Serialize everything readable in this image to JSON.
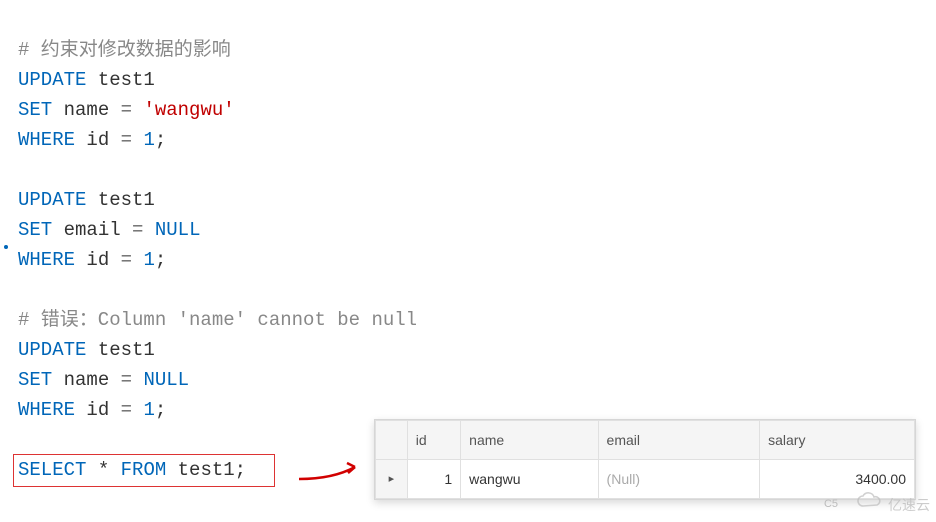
{
  "code": {
    "comment1": "# 约束对修改数据的影响",
    "kw_update1": "UPDATE",
    "tbl": "test1",
    "kw_set1": "SET",
    "field_name": "name",
    "op_eq": "=",
    "str_wangwu": "'wangwu'",
    "kw_where1": "WHERE",
    "field_id": "id",
    "num1": "1",
    "semi": ";",
    "kw_update2": "UPDATE",
    "kw_set2": "SET",
    "field_email": "email",
    "kw_null": "NULL",
    "kw_where2": "WHERE",
    "comment2": "# 错误：Column 'name' cannot be null",
    "kw_update3": "UPDATE",
    "kw_set3": "SET",
    "kw_where3": "WHERE",
    "kw_select": "SELECT",
    "star": "*",
    "kw_from": "FROM"
  },
  "result": {
    "headers": [
      "id",
      "name",
      "email",
      "salary"
    ],
    "rowmark": "▸",
    "row": {
      "id": "1",
      "name": "wangwu",
      "email": "(Null)",
      "salary": "3400.00"
    }
  },
  "watermark": {
    "text": "亿速云",
    "corner": "C5"
  },
  "chart_data": {
    "type": "table",
    "columns": [
      "id",
      "name",
      "email",
      "salary"
    ],
    "rows": [
      [
        1,
        "wangwu",
        null,
        3400.0
      ]
    ]
  }
}
